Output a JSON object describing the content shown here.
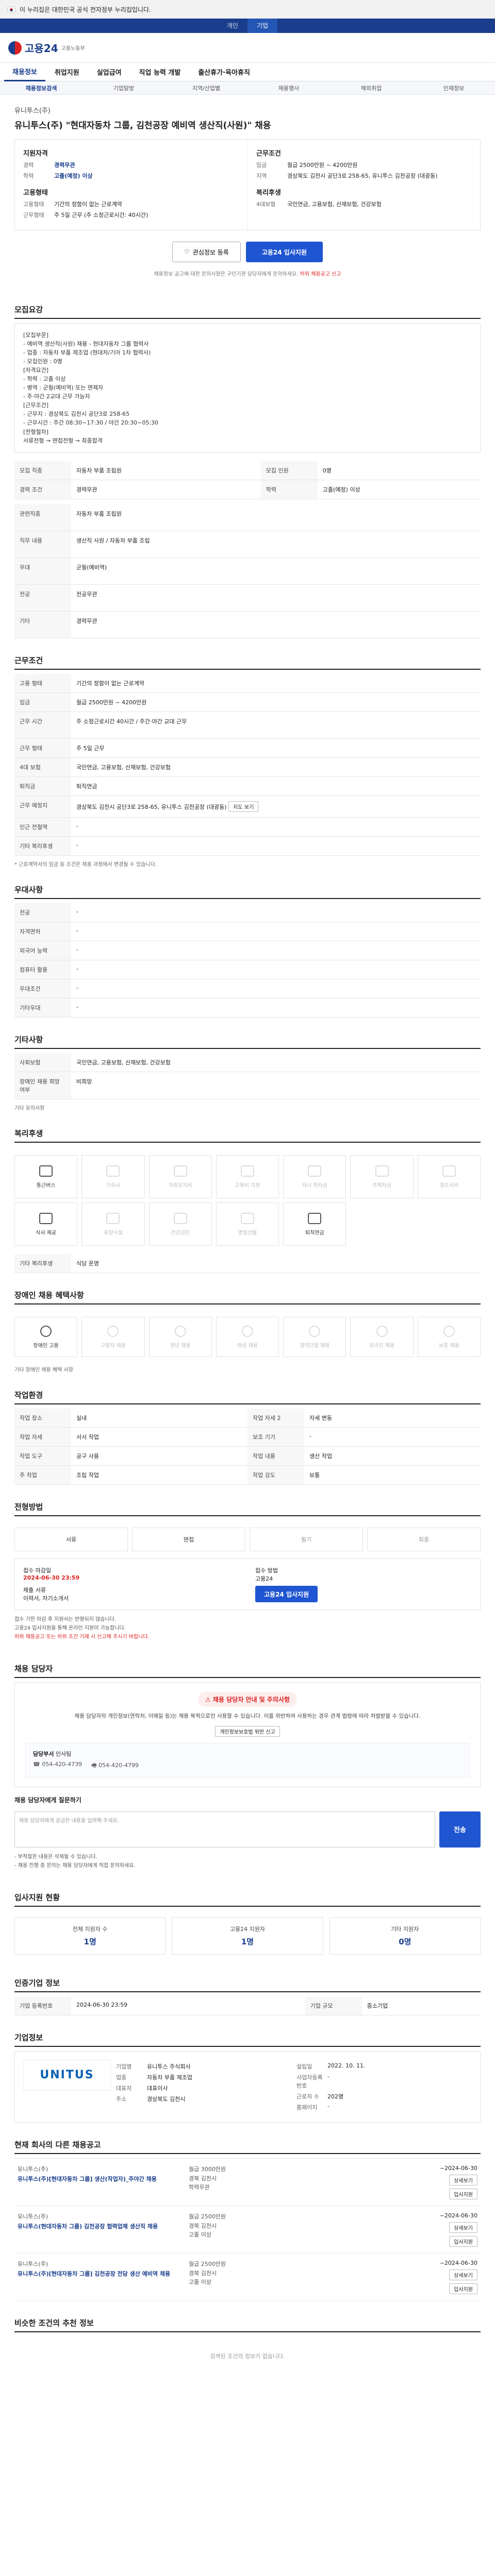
{
  "gov_banner": "이 누리집은 대한민국 공식 전자정부 누리집입니다.",
  "topbar": {
    "tabs": [
      "개인",
      "기업"
    ],
    "active": "기업"
  },
  "site": {
    "logo": "고용24",
    "sub": "고용노동부"
  },
  "gnb": [
    "채용정보",
    "취업지원",
    "실업급여",
    "직업 능력 개발",
    "출산휴가·육아휴직"
  ],
  "subnav": [
    "채용정보검색",
    "기업탐방",
    "지역/산업별",
    "채용행사",
    "해외취업",
    "인재정보"
  ],
  "job": {
    "company": "유니투스(주)",
    "title": "유니투스(주) \"현대자동차 그룹, 김천공장 예비역 생산직(사원)\" 채용",
    "left_title": "지원자격",
    "left_rows": [
      {
        "k": "경력",
        "v": "경력무관"
      },
      {
        "k": "학력",
        "v": "고졸(예정) 이상"
      }
    ],
    "left_title2": "고용형태",
    "left_rows2": [
      {
        "k": "고용형태",
        "v": "기간의 정함이 없는 근로계약"
      },
      {
        "k": "근무형태",
        "v": "주 5일 근무 (주 소정근로시간: 40시간)"
      }
    ],
    "right_title": "근무조건",
    "right_rows": [
      {
        "k": "임금",
        "v": "월급 2500만원 ~ 4200만원"
      },
      {
        "k": "지역",
        "v": "경상북도 김천시 공단3로 258-65, 유니투스 김천공장 (대광동)"
      }
    ],
    "right_title2": "복리후생",
    "right_rows2": [
      {
        "k": "4대보험",
        "v": "국민연금, 고용보험, 산재보험, 건강보험"
      }
    ],
    "btn_scrap": "관심정보 등록",
    "btn_apply": "고용24 입사지원",
    "notice": "채용정보 공고에 대한 문의사항은 구인기관 담당자에게 문의하세요.",
    "notice_red": "허위 채용공고 신고"
  },
  "recruit": {
    "title": "모집요강",
    "lines": [
      "[모집부문]",
      "- 예비역 생산직(사원) 채용 - 현대자동차 그룹 협력사",
      "- 업종 : 자동차 부품 제조업 (현대차/기아 1차 협력사)",
      "- 모집인원 : 0명",
      "",
      "[자격요건]",
      "- 학력 : 고졸 이상",
      "- 병역 : 군필(예비역) 또는 면제자",
      "- 주·야간 2교대 근무 가능자",
      "",
      "[근무조건]",
      "- 근무지 : 경상북도 김천시 공단3로 258-65",
      "- 근무시간 : 주간 08:30~17:30 / 야간 20:30~05:30",
      "",
      "[전형절차]",
      "서류전형 → 면접전형 → 최종합격"
    ],
    "table": [
      {
        "k": "모집 직종",
        "v": "자동차 부품 조립원"
      },
      {
        "k": "모집 인원",
        "v": "0명"
      },
      {
        "k": "경력 조건",
        "v": "경력무관"
      },
      {
        "k": "학력",
        "v": "고졸(예정) 이상"
      }
    ],
    "table2": [
      {
        "k": "관련직종",
        "v": "자동차 부품 조립원"
      },
      {
        "k": "직무 내용",
        "v": "생산직 사원 / 자동차 부품 조립"
      },
      {
        "k": "우대",
        "v": "군필(예비역)"
      },
      {
        "k": "전공",
        "v": "전공무관"
      },
      {
        "k": "기타",
        "v": "경력무관"
      }
    ]
  },
  "condition": {
    "title": "근무조건",
    "rows": [
      {
        "k": "고용 형태",
        "v": "기간의 정함이 없는 근로계약"
      },
      {
        "k": "임금",
        "v": "월급 2500만원 ~ 4200만원"
      },
      {
        "k": "근무 시간",
        "v": "주 소정근로시간 40시간 / 주간·야간 교대 근무"
      },
      {
        "k": "근무 형태",
        "v": "주 5일 근무"
      },
      {
        "k": "4대 보험",
        "v": "국민연금, 고용보험, 산재보험, 건강보험"
      },
      {
        "k": "퇴직금",
        "v": "퇴직연금"
      },
      {
        "k": "근무 예정지",
        "v": "경상북도 김천시 공단3로 258-65, 유니투스 김천공장 (대광동)"
      },
      {
        "k": "인근 전철역",
        "v": "-"
      },
      {
        "k": "기타 복리후생",
        "v": "-"
      }
    ],
    "map_btn": "지도 보기",
    "note": "* 근로계약서의 임금 등 조건은 채용 과정에서 변경될 수 있습니다."
  },
  "qual": {
    "title": "우대사항",
    "rows": [
      {
        "k": "전공",
        "v": "-"
      },
      {
        "k": "자격면허",
        "v": "-"
      },
      {
        "k": "외국어 능력",
        "v": "-"
      },
      {
        "k": "컴퓨터 활용",
        "v": "-"
      },
      {
        "k": "우대조건",
        "v": "-"
      },
      {
        "k": "기타우대",
        "v": "-"
      }
    ]
  },
  "other": {
    "title": "기타사항",
    "rows": [
      {
        "k": "사회보험",
        "v": "국민연금, 고용보험, 산재보험, 건강보험"
      },
      {
        "k": "장애인 채용 희망 여부",
        "v": "비희망"
      }
    ],
    "extra": "기타 유의사항"
  },
  "welfare": {
    "title": "복리후생",
    "items": [
      {
        "label": "통근버스",
        "on": true
      },
      {
        "label": "기숙사",
        "on": false
      },
      {
        "label": "차량유지비",
        "on": false
      },
      {
        "label": "교육비 지원",
        "on": false
      },
      {
        "label": "자녀 학자금",
        "on": false
      },
      {
        "label": "주택자금",
        "on": false
      },
      {
        "label": "경조사비",
        "on": false
      },
      {
        "label": "식사 제공",
        "on": true
      },
      {
        "label": "휴양시설",
        "on": false
      },
      {
        "label": "건강검진",
        "on": false
      },
      {
        "label": "명절선물",
        "on": false
      },
      {
        "label": "퇴직연금",
        "on": true
      }
    ],
    "extra_k": "기타 복리후생",
    "extra_v": "식당 운영"
  },
  "hiring": {
    "title": "장애인 채용 혜택사항",
    "items": [
      {
        "label": "장애인 고용",
        "on": true
      },
      {
        "label": "고령자 채용",
        "on": false
      },
      {
        "label": "청년 채용",
        "on": false
      },
      {
        "label": "여성 채용",
        "on": false
      },
      {
        "label": "경력단절 채용",
        "on": false
      },
      {
        "label": "외국인 채용",
        "on": false
      },
      {
        "label": "보훈 채용",
        "on": false
      }
    ],
    "extra": "기타 장애인 채용 혜택 사항"
  },
  "env": {
    "title": "작업환경",
    "rows": [
      {
        "k": "작업 장소",
        "v": "실내"
      },
      {
        "k": "작업 자세",
        "v": "서서 작업"
      },
      {
        "k": "작업 도구",
        "v": "공구 사용"
      },
      {
        "k": "주 작업",
        "v": "조립 작업"
      }
    ],
    "rows_r": [
      {
        "k": "작업 자세 2",
        "v": "자세 변동"
      },
      {
        "k": "보조 기기",
        "v": "-"
      },
      {
        "k": "작업 내용",
        "v": "생산 작업"
      },
      {
        "k": "작업 강도",
        "v": "보통"
      }
    ]
  },
  "process": {
    "title": "전형방법",
    "steps": [
      {
        "label": "서류",
        "on": true
      },
      {
        "label": "면접",
        "on": true
      },
      {
        "label": "필기",
        "on": false
      },
      {
        "label": "최종",
        "on": false
      }
    ]
  },
  "apply": {
    "deadline_k": "접수 마감일",
    "deadline_v": "2024-06-30 23:59",
    "method_k": "접수 방법",
    "method_v": "고용24",
    "doc_k": "제출 서류",
    "doc_v": "이력서, 자기소개서",
    "btn": "고용24 입사지원",
    "notes": [
      "접수 기한 마감 후 지원서는 반영되지 않습니다.",
      "고용24 입사지원을 통해 온라인 지원이 가능합니다.",
      "허위 채용공고 또는 허위 조건 기재 시 신고해 주시기 바랍니다."
    ]
  },
  "contact": {
    "title": "채용 담당자",
    "warn": "채용 담당자 안내 및 주의사항",
    "desc": "채용 담당자의 개인정보(연락처, 이메일 등)는 채용 목적으로만 사용할 수 있습니다. 이를 위반하여 사용하는 경우 관계 법령에 따라 처벌받을 수 있습니다.",
    "btn": "개인정보보호법 위반 신고",
    "name_k": "담당부서",
    "name_v": "인사팀",
    "tel": "054-420-4739",
    "fax": "054-420-4799"
  },
  "inquiry": {
    "title": "채용 담당자에게 질문하기",
    "placeholder": "채용 담당자에게 궁금한 내용을 입력해 주세요.",
    "send": "전송",
    "notes": [
      "- 부적절한 내용은 삭제될 수 있습니다.",
      "- 채용 진행 중 문의는 채용 담당자에게 직접 문의하세요."
    ]
  },
  "stats": {
    "title": "입사지원 현황",
    "items": [
      {
        "label": "전체 지원자 수",
        "num": "1명"
      },
      {
        "label": "고용24 지원자",
        "num": "1명"
      },
      {
        "label": "기타 지원자",
        "num": "0명"
      }
    ]
  },
  "history": {
    "title": "인증기업 정보",
    "rows": [
      {
        "k": "기업 등록번호",
        "v": "2024-06-30 23:59"
      },
      {
        "k": "기업 규모",
        "v": "중소기업"
      }
    ]
  },
  "company": {
    "title": "기업정보",
    "logo": "UNITUS",
    "rows": [
      {
        "k": "기업명",
        "v": "유니투스 주식회사"
      },
      {
        "k": "업종",
        "v": "자동차 부품 제조업"
      },
      {
        "k": "대표자",
        "v": "대표이사"
      },
      {
        "k": "주소",
        "v": "경상북도 김천시"
      }
    ],
    "rows_r": [
      {
        "k": "설립일",
        "v": "2022. 10. 11."
      },
      {
        "k": "사업자등록번호",
        "v": "-"
      },
      {
        "k": "근로자 수",
        "v": "202명"
      },
      {
        "k": "홈페이지",
        "v": "-"
      }
    ]
  },
  "others": {
    "title": "현재 회사의 다른 채용공고",
    "jobs": [
      {
        "cname": "유니투스(주)",
        "title": "유니투스(주)[현대자동차 그룹] 생산(작업자)_주야간 채용",
        "wage": "월급 3000만원",
        "loc": "경북 김천시",
        "edu": "학력무관",
        "date": "~2024-06-30"
      },
      {
        "cname": "유니투스(주)",
        "title": "유니투스(현대자동차 그룹) 김천공장 협력업체 생산직 채용",
        "wage": "월급 2500만원",
        "loc": "경북 김천시",
        "edu": "고졸 이상",
        "date": "~2024-06-30"
      },
      {
        "cname": "유니투스(주)",
        "title": "유니투스(주)[현대자동차 그룹] 김천공장 전담 생산 예비역 채용",
        "wage": "월급 2500만원",
        "loc": "경북 김천시",
        "edu": "고졸 이상",
        "date": "~2024-06-30"
      }
    ],
    "btn_view": "상세보기",
    "btn_apply": "입사지원"
  },
  "similar": {
    "title": "비슷한 조건의 추천 정보",
    "empty": "검색된 조건의 정보가 없습니다."
  }
}
